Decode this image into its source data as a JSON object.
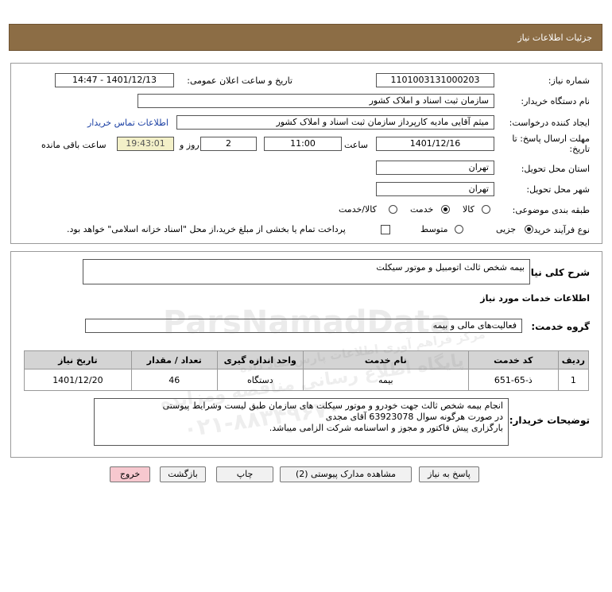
{
  "header": {
    "title": "جزئیات اطلاعات نیاز"
  },
  "form": {
    "need_number_label": "شماره نیاز:",
    "need_number": "1101003131000203",
    "announce_label": "تاریخ و ساعت اعلان عمومی:",
    "announce_value": "1401/12/13 - 14:47",
    "buyer_label": "نام دستگاه خریدار:",
    "buyer": "سازمان ثبت اسناد و املاک کشور",
    "creator_label": "ایجاد کننده درخواست:",
    "creator": "میثم آقایی مادیه کارپرداز سازمان ثبت اسناد و املاک کشور",
    "contact_link": "اطلاعات تماس خریدار",
    "deadline_label": "مهلت ارسال پاسخ: تا",
    "deadline_label2": "تاریخ:",
    "deadline_date": "1401/12/16",
    "time_label": "ساعت",
    "deadline_time": "11:00",
    "days": "2",
    "days_label": "روز و",
    "remaining_time": "19:43:01",
    "remaining_label": "ساعت باقی مانده",
    "province_label": "استان محل تحویل:",
    "province": "تهران",
    "city_label": "شهر محل تحویل:",
    "city": "تهران",
    "category_label": "طبقه بندی موضوعی:",
    "category_options": [
      "کالا",
      "خدمت",
      "کالا/خدمت"
    ],
    "category_selected": "خدمت",
    "process_label": "نوع فرآیند خرید :",
    "process_options": [
      "جزیی",
      "متوسط"
    ],
    "process_selected": "جزیی",
    "payment_note": "پرداخت تمام یا بخشی از مبلغ خرید،از محل \"اسناد خزانه اسلامی\" خواهد بود."
  },
  "details": {
    "summary_label": "شرح کلی نیاز:",
    "summary": "بیمه شخص ثالث اتومبیل و موتور سیکلت",
    "services_heading": "اطلاعات خدمات مورد نیاز",
    "service_group_label": "گروه خدمت:",
    "service_group": "فعالیت‌های مالی و بیمه",
    "table": {
      "headers": [
        "ردیف",
        "کد خدمت",
        "نام خدمت",
        "واحد اندازه گیری",
        "تعداد / مقدار",
        "تاریخ نیاز"
      ],
      "rows": [
        [
          "1",
          "ذ-65-651",
          "بیمه",
          "دستگاه",
          "46",
          "1401/12/20"
        ]
      ]
    },
    "buyer_notes_label": "توضیحات خریدار:",
    "buyer_notes": [
      "انجام بیمه شخص ثالث جهت خودرو و موتور سیکلت های سازمان طبق لیست وشرایط پیوستی",
      "در صورت هرگونه سوال 63923078 آقای مجدی",
      "بارگزاری پیش فاکتور و مجوز و اساسنامه شرکت الزامی میباشد."
    ]
  },
  "buttons": {
    "reply": "پاسخ به نیاز",
    "view_docs": "مشاهده مدارک پیوستی (2)",
    "print": "چاپ",
    "back": "بازگشت",
    "exit": "خروج"
  },
  "watermark": {
    "line1": "ParsNamadData",
    "line2": "مرکز فراهم آوری اطلاعات پارس نماد داده",
    "line3": "پایگاه اطلاع رسانی مناقصه ومزایده",
    "line4": "۰۲۱-۸۸۳۴۹۶۷۰"
  },
  "colors": {
    "header_bg": "#8c6d45",
    "link": "#1a3fa3",
    "remaining_bg": "#f3f0c8",
    "exit_bg": "#f7c8cf"
  }
}
